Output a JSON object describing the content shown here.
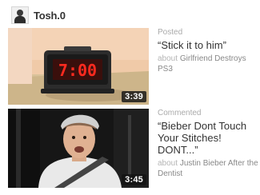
{
  "channel": {
    "name": "Tosh.0",
    "avatar_icon": "channel-avatar"
  },
  "activity": [
    {
      "action": "Posted",
      "title": "“Stick it to him”",
      "about_word": "about",
      "about_target": "Girlfriend Destroys PS3",
      "duration": "3:39",
      "thumbnail": "clock-display-thumbnail",
      "clock_text": "7:00"
    },
    {
      "action": "Commented",
      "title": "“Bieber Dont Touch Your Stitches! DONT...”",
      "about_word": "about",
      "about_target": "Justin Bieber After the Dentist",
      "duration": "3:45",
      "thumbnail": "boy-in-car-thumbnail"
    }
  ],
  "colors": {
    "accent_text": "#333333",
    "muted_text": "#aaaaaa",
    "clock_digits": "#ff2a1f",
    "thumb_wall": "#f1c9a9"
  }
}
